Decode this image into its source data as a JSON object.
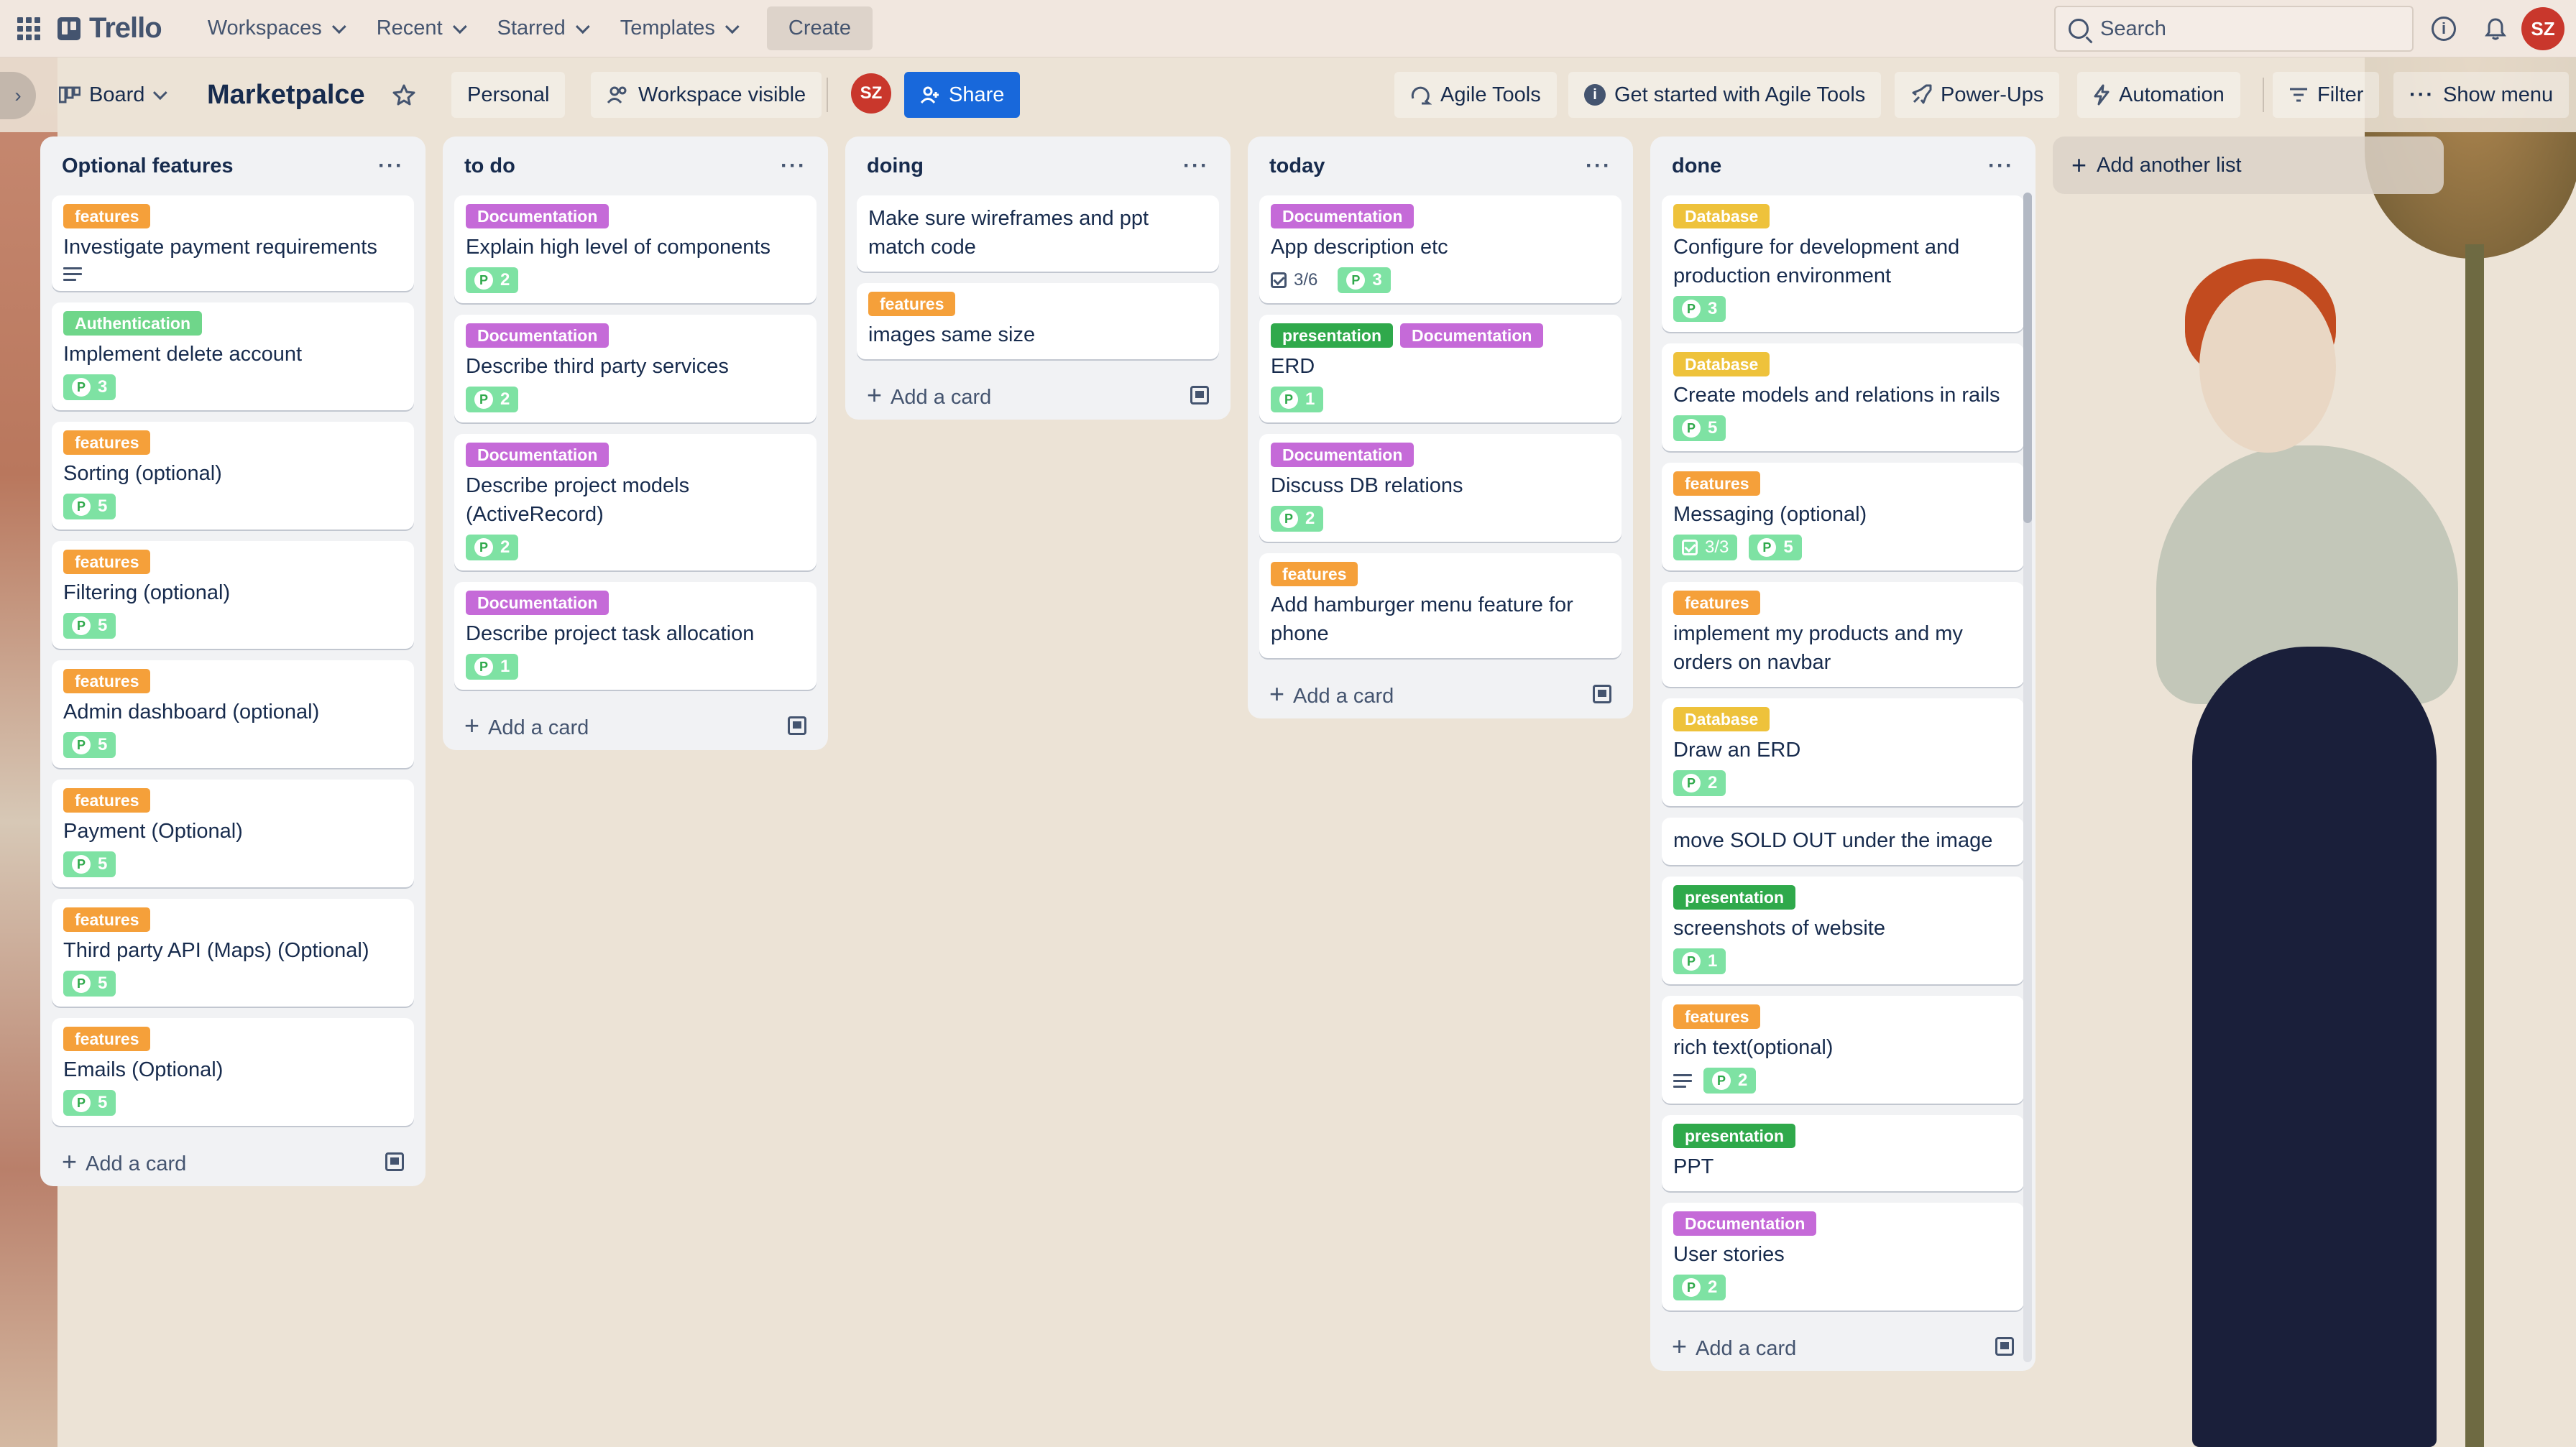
{
  "app": {
    "name": "Trello"
  },
  "topnav": {
    "menus": [
      "Workspaces",
      "Recent",
      "Starred",
      "Templates"
    ],
    "create_label": "Create",
    "search_placeholder": "Search",
    "user_initials": "SZ"
  },
  "board": {
    "view_label": "Board",
    "title": "Marketpalce",
    "workspace_label": "Personal",
    "visibility_label": "Workspace visible",
    "member_initials": "SZ",
    "share_label": "Share",
    "tools": {
      "agile": "Agile Tools",
      "get_started": "Get started with Agile Tools",
      "powerups": "Power-Ups",
      "automation": "Automation",
      "filter": "Filter",
      "show_menu": "Show menu"
    },
    "add_list_label": "Add another list",
    "add_card_label": "Add a card"
  },
  "colors": {
    "features": "#f5a03a",
    "Documentation": "#c56ad8",
    "Database": "#eec23b",
    "Authentication": "#6fd68a",
    "presentation": "#2fa94b",
    "share_button": "#1868db",
    "avatar": "#c9372c"
  },
  "lists": [
    {
      "title": "Optional features",
      "cards": [
        {
          "labels": [
            "features"
          ],
          "title": "Investigate payment requirements",
          "description": true
        },
        {
          "labels": [
            "Authentication"
          ],
          "title": "Implement delete account",
          "points": "3"
        },
        {
          "labels": [
            "features"
          ],
          "title": "Sorting (optional)",
          "points": "5"
        },
        {
          "labels": [
            "features"
          ],
          "title": "Filtering (optional)",
          "points": "5"
        },
        {
          "labels": [
            "features"
          ],
          "title": "Admin dashboard (optional)",
          "points": "5"
        },
        {
          "labels": [
            "features"
          ],
          "title": "Payment (Optional)",
          "points": "5"
        },
        {
          "labels": [
            "features"
          ],
          "title": "Third party API (Maps) (Optional)",
          "points": "5"
        },
        {
          "labels": [
            "features"
          ],
          "title": "Emails (Optional)",
          "points": "5"
        }
      ]
    },
    {
      "title": "to do",
      "cards": [
        {
          "labels": [
            "Documentation"
          ],
          "title": "Explain high level of components",
          "points": "2"
        },
        {
          "labels": [
            "Documentation"
          ],
          "title": "Describe third party services",
          "points": "2"
        },
        {
          "labels": [
            "Documentation"
          ],
          "title": "Describe project models (ActiveRecord)",
          "points": "2"
        },
        {
          "labels": [
            "Documentation"
          ],
          "title": "Describe project task allocation",
          "points": "1"
        }
      ]
    },
    {
      "title": "doing",
      "cards": [
        {
          "labels": [],
          "title": "Make sure wireframes and ppt match code"
        },
        {
          "labels": [
            "features"
          ],
          "title": "images same size"
        }
      ]
    },
    {
      "title": "today",
      "cards": [
        {
          "labels": [
            "Documentation"
          ],
          "title": "App description etc",
          "checklist": "3/6",
          "points": "3"
        },
        {
          "labels": [
            "presentation",
            "Documentation"
          ],
          "title": "ERD",
          "points": "1"
        },
        {
          "labels": [
            "Documentation"
          ],
          "title": "Discuss DB relations",
          "points": "2"
        },
        {
          "labels": [
            "features"
          ],
          "title": "Add hamburger menu feature for phone"
        }
      ]
    },
    {
      "title": "done",
      "cards": [
        {
          "labels": [
            "Database"
          ],
          "title": "Configure for development and production environment",
          "points": "3"
        },
        {
          "labels": [
            "Database"
          ],
          "title": "Create models and relations in rails",
          "points": "5"
        },
        {
          "labels": [
            "features"
          ],
          "title": "Messaging (optional)",
          "checklist": "3/3",
          "checklist_done": true,
          "points": "5"
        },
        {
          "labels": [
            "features"
          ],
          "title": "implement my products and my orders on navbar"
        },
        {
          "labels": [
            "Database"
          ],
          "title": "Draw an ERD",
          "points": "2"
        },
        {
          "labels": [],
          "title": "move SOLD OUT under the image"
        },
        {
          "labels": [
            "presentation"
          ],
          "title": "screenshots of website",
          "points": "1"
        },
        {
          "labels": [
            "features"
          ],
          "title": "rich text(optional)",
          "description": true,
          "points": "2"
        },
        {
          "labels": [
            "presentation"
          ],
          "title": "PPT"
        },
        {
          "labels": [
            "Documentation"
          ],
          "title": "User stories",
          "points": "2"
        }
      ]
    }
  ]
}
